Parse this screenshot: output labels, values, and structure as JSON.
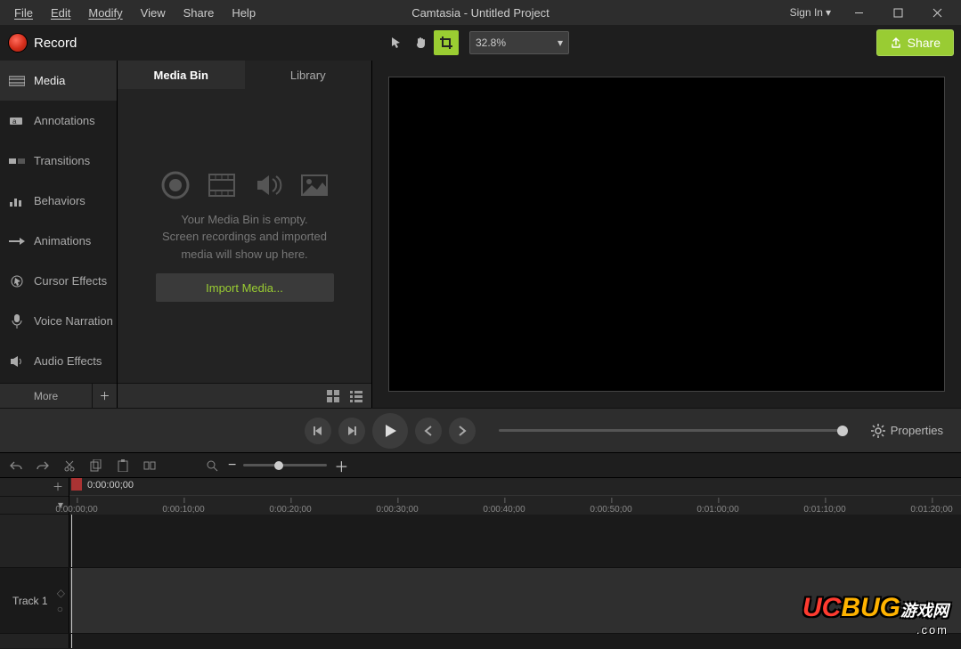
{
  "app": {
    "title": "Camtasia - Untitled Project"
  },
  "menu": {
    "file": "File",
    "edit": "Edit",
    "modify": "Modify",
    "view": "View",
    "share": "Share",
    "help": "Help"
  },
  "auth": {
    "signin": "Sign In"
  },
  "toolbar": {
    "record": "Record",
    "zoom": "32.8%",
    "share": "Share"
  },
  "sidetabs": {
    "media": "Media",
    "annotations": "Annotations",
    "transitions": "Transitions",
    "behaviors": "Behaviors",
    "animations": "Animations",
    "cursor": "Cursor Effects",
    "voice": "Voice Narration",
    "audio": "Audio Effects",
    "more": "More"
  },
  "mediapanel": {
    "tab_bin": "Media Bin",
    "tab_library": "Library",
    "empty_line1": "Your Media Bin is empty.",
    "empty_line2": "Screen recordings and imported",
    "empty_line3": "media will show up here.",
    "import": "Import Media..."
  },
  "playback": {
    "properties": "Properties"
  },
  "timeline": {
    "cursor_time": "0:00:00;00",
    "ticks": [
      "0:00:00;00",
      "0:00:10;00",
      "0:00:20;00",
      "0:00:30;00",
      "0:00:40;00",
      "0:00:50;00",
      "0:01:00;00",
      "0:01:10;00",
      "0:01:20;00"
    ],
    "track1": "Track 1"
  },
  "watermark": {
    "line1": "UCBUG",
    "line2": ".com",
    "suffix": "游戏网"
  }
}
